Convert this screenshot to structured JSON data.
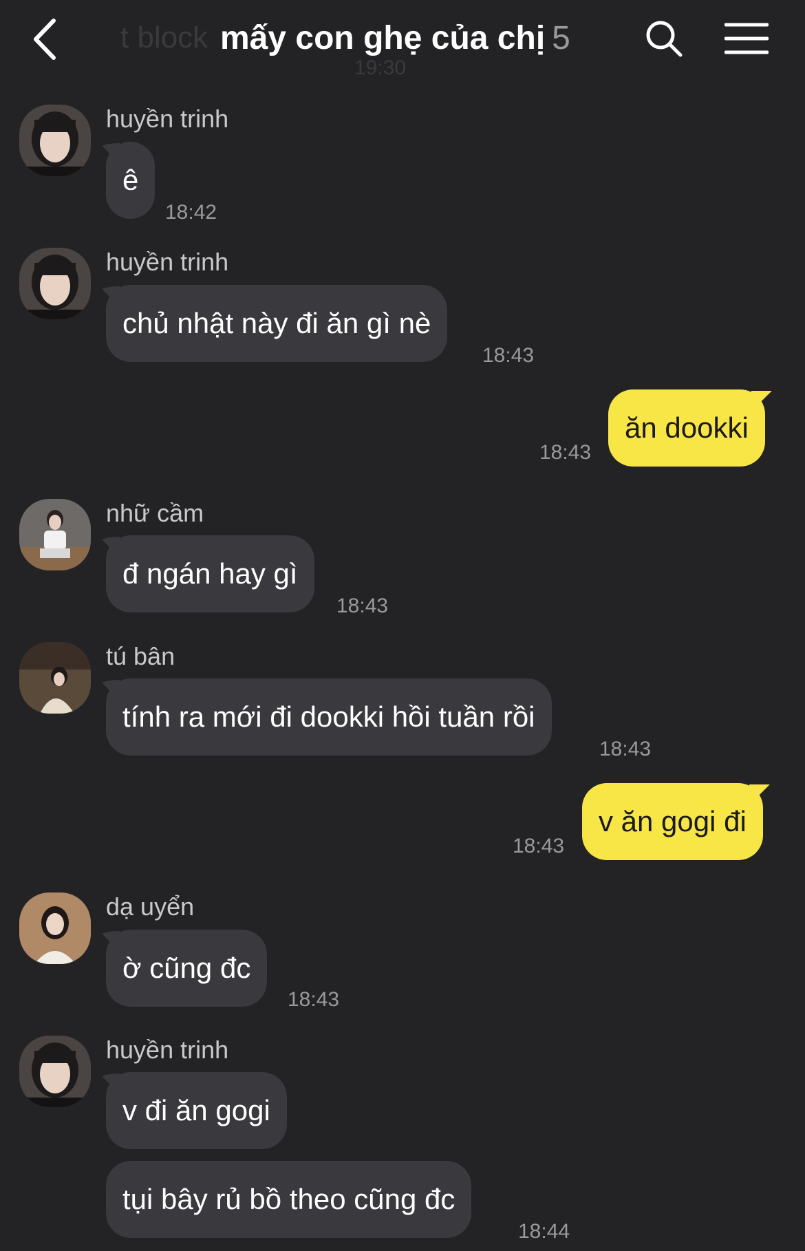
{
  "header": {
    "title": "mấy con ghẹ của chị",
    "member_count": "5",
    "ghost_text": "t block",
    "ghost_time": "19:30"
  },
  "messages": [
    {
      "sender": "huyền trinh",
      "text": "ê",
      "time": "18:42"
    },
    {
      "sender": "huyền trinh",
      "text": "chủ nhật này đi ăn gì nè",
      "time": "18:43"
    },
    {
      "sender": "me",
      "text": "ăn dookki",
      "time": "18:43"
    },
    {
      "sender": "nhữ cầm",
      "text": "đ ngán hay gì",
      "time": "18:43"
    },
    {
      "sender": "tú bân",
      "text": "tính ra mới đi dookki hồi tuần rồi",
      "time": "18:43"
    },
    {
      "sender": "me",
      "text": "v ăn gogi đi",
      "time": "18:43"
    },
    {
      "sender": "dạ uyển",
      "text": "ờ cũng đc",
      "time": "18:43"
    },
    {
      "sender": "huyền trinh",
      "text": "v đi ăn gogi",
      "time": ""
    },
    {
      "sender": "huyền trinh",
      "text": "tụi bây rủ bồ theo cũng đc",
      "time": "18:44"
    }
  ],
  "colors": {
    "background": "#232326",
    "incoming_bubble": "#3a3a3e",
    "outgoing_bubble": "#f8e546",
    "timestamp": "#9a9a9e"
  },
  "icons": [
    "back-arrow-icon",
    "search-icon",
    "menu-icon"
  ]
}
